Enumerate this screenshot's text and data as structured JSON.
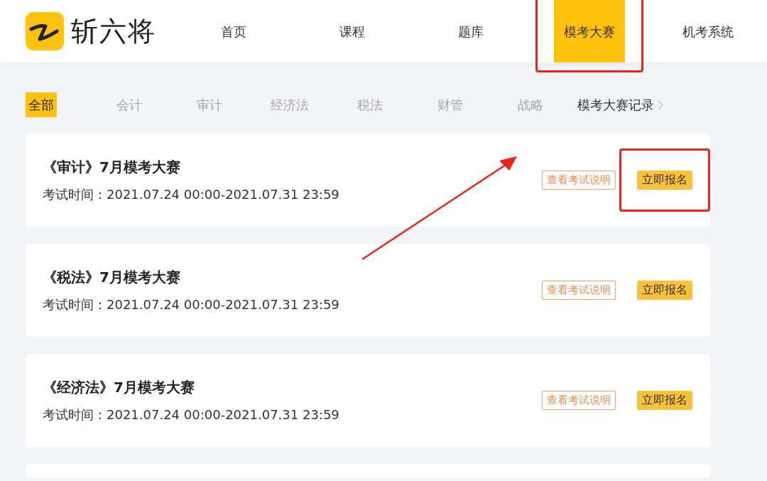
{
  "brand": {
    "name": "斩六将"
  },
  "nav": [
    {
      "label": "首页",
      "selected": false,
      "highlighted": false
    },
    {
      "label": "课程",
      "selected": false,
      "highlighted": false
    },
    {
      "label": "题库",
      "selected": false,
      "highlighted": false
    },
    {
      "label": "模考大赛",
      "selected": true,
      "highlighted": true
    },
    {
      "label": "机考系统",
      "selected": false,
      "highlighted": false
    }
  ],
  "filters": [
    {
      "label": "全部",
      "selected": true
    },
    {
      "label": "会计",
      "selected": false
    },
    {
      "label": "审计",
      "selected": false
    },
    {
      "label": "经济法",
      "selected": false
    },
    {
      "label": "税法",
      "selected": false
    },
    {
      "label": "财管",
      "selected": false
    },
    {
      "label": "战略",
      "selected": false
    }
  ],
  "records_link": {
    "label": "模考大赛记录"
  },
  "contests": [
    {
      "title": "《审计》7月模考大赛",
      "time": "考试时间：2021.07.24 00:00-2021.07.31 23:59",
      "info_button": "查看考试说明",
      "signup_button": "立即报名",
      "highlighted": true
    },
    {
      "title": "《税法》7月模考大赛",
      "time": "考试时间：2021.07.24 00:00-2021.07.31 23:59",
      "info_button": "查看考试说明",
      "signup_button": "立即报名",
      "highlighted": false
    },
    {
      "title": "《经济法》7月模考大赛",
      "time": "考试时间：2021.07.24 00:00-2021.07.31 23:59",
      "info_button": "查看考试说明",
      "signup_button": "立即报名",
      "highlighted": false
    }
  ],
  "pointer_arrow": true
}
